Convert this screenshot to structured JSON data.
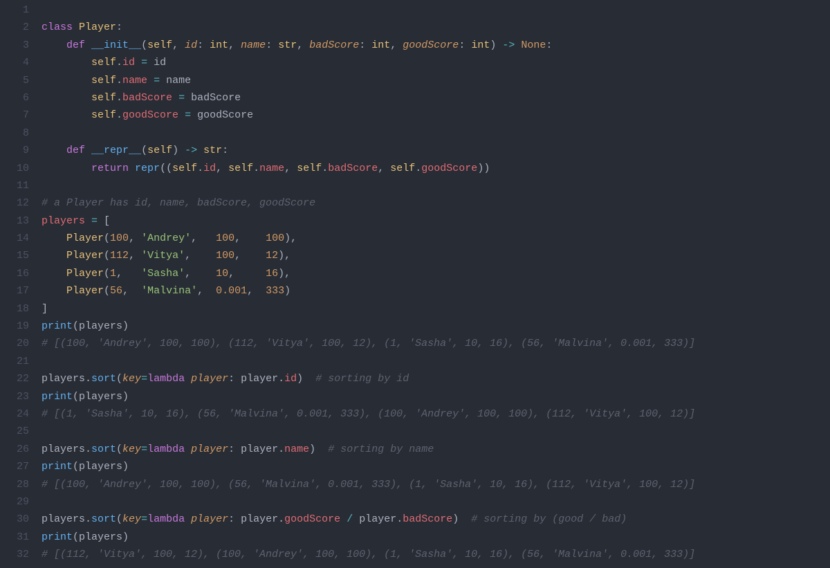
{
  "lineCount": 32,
  "lines": [
    [],
    [
      [
        "k",
        "class"
      ],
      [
        "p",
        " "
      ],
      [
        "cls",
        "Player"
      ],
      [
        "p",
        ":"
      ]
    ],
    [
      [
        "p",
        "    "
      ],
      [
        "k",
        "def"
      ],
      [
        "p",
        " "
      ],
      [
        "fn",
        "__init__"
      ],
      [
        "p",
        "("
      ],
      [
        "self",
        "self"
      ],
      [
        "p",
        ", "
      ],
      [
        "par",
        "id"
      ],
      [
        "p",
        ": "
      ],
      [
        "cls",
        "int"
      ],
      [
        "p",
        ", "
      ],
      [
        "par",
        "name"
      ],
      [
        "p",
        ": "
      ],
      [
        "cls",
        "str"
      ],
      [
        "p",
        ", "
      ],
      [
        "par",
        "badScore"
      ],
      [
        "p",
        ": "
      ],
      [
        "cls",
        "int"
      ],
      [
        "p",
        ", "
      ],
      [
        "par",
        "goodScore"
      ],
      [
        "p",
        ": "
      ],
      [
        "cls",
        "int"
      ],
      [
        "p",
        ") "
      ],
      [
        "op",
        "->"
      ],
      [
        "p",
        " "
      ],
      [
        "none",
        "None"
      ],
      [
        "p",
        ":"
      ]
    ],
    [
      [
        "p",
        "        "
      ],
      [
        "self",
        "self"
      ],
      [
        "p",
        "."
      ],
      [
        "attr",
        "id"
      ],
      [
        "p",
        " "
      ],
      [
        "op",
        "="
      ],
      [
        "p",
        " "
      ],
      [
        "p",
        "id"
      ]
    ],
    [
      [
        "p",
        "        "
      ],
      [
        "self",
        "self"
      ],
      [
        "p",
        "."
      ],
      [
        "attr",
        "name"
      ],
      [
        "p",
        " "
      ],
      [
        "op",
        "="
      ],
      [
        "p",
        " "
      ],
      [
        "p",
        "name"
      ]
    ],
    [
      [
        "p",
        "        "
      ],
      [
        "self",
        "self"
      ],
      [
        "p",
        "."
      ],
      [
        "attr",
        "badScore"
      ],
      [
        "p",
        " "
      ],
      [
        "op",
        "="
      ],
      [
        "p",
        " "
      ],
      [
        "p",
        "badScore"
      ]
    ],
    [
      [
        "p",
        "        "
      ],
      [
        "self",
        "self"
      ],
      [
        "p",
        "."
      ],
      [
        "attr",
        "goodScore"
      ],
      [
        "p",
        " "
      ],
      [
        "op",
        "="
      ],
      [
        "p",
        " "
      ],
      [
        "p",
        "goodScore"
      ]
    ],
    [],
    [
      [
        "p",
        "    "
      ],
      [
        "k",
        "def"
      ],
      [
        "p",
        " "
      ],
      [
        "fn",
        "__repr__"
      ],
      [
        "p",
        "("
      ],
      [
        "self",
        "self"
      ],
      [
        "p",
        ") "
      ],
      [
        "op",
        "->"
      ],
      [
        "p",
        " "
      ],
      [
        "cls",
        "str"
      ],
      [
        "p",
        ":"
      ]
    ],
    [
      [
        "p",
        "        "
      ],
      [
        "k",
        "return"
      ],
      [
        "p",
        " "
      ],
      [
        "fn",
        "repr"
      ],
      [
        "p",
        "(("
      ],
      [
        "self",
        "self"
      ],
      [
        "p",
        "."
      ],
      [
        "attr",
        "id"
      ],
      [
        "p",
        ", "
      ],
      [
        "self",
        "self"
      ],
      [
        "p",
        "."
      ],
      [
        "attr",
        "name"
      ],
      [
        "p",
        ", "
      ],
      [
        "self",
        "self"
      ],
      [
        "p",
        "."
      ],
      [
        "attr",
        "badScore"
      ],
      [
        "p",
        ", "
      ],
      [
        "self",
        "self"
      ],
      [
        "p",
        "."
      ],
      [
        "attr",
        "goodScore"
      ],
      [
        "p",
        "))"
      ]
    ],
    [],
    [
      [
        "c",
        "# a Player has id, name, badScore, goodScore"
      ]
    ],
    [
      [
        "var",
        "players"
      ],
      [
        "p",
        " "
      ],
      [
        "op",
        "="
      ],
      [
        "p",
        " ["
      ]
    ],
    [
      [
        "p",
        "    "
      ],
      [
        "cls",
        "Player"
      ],
      [
        "p",
        "("
      ],
      [
        "n",
        "100"
      ],
      [
        "p",
        ", "
      ],
      [
        "s",
        "'Andrey'"
      ],
      [
        "p",
        ",   "
      ],
      [
        "n",
        "100"
      ],
      [
        "p",
        ",    "
      ],
      [
        "n",
        "100"
      ],
      [
        "p",
        "),"
      ]
    ],
    [
      [
        "p",
        "    "
      ],
      [
        "cls",
        "Player"
      ],
      [
        "p",
        "("
      ],
      [
        "n",
        "112"
      ],
      [
        "p",
        ", "
      ],
      [
        "s",
        "'Vitya'"
      ],
      [
        "p",
        ",    "
      ],
      [
        "n",
        "100"
      ],
      [
        "p",
        ",    "
      ],
      [
        "n",
        "12"
      ],
      [
        "p",
        "),"
      ]
    ],
    [
      [
        "p",
        "    "
      ],
      [
        "cls",
        "Player"
      ],
      [
        "p",
        "("
      ],
      [
        "n",
        "1"
      ],
      [
        "p",
        ",   "
      ],
      [
        "s",
        "'Sasha'"
      ],
      [
        "p",
        ",    "
      ],
      [
        "n",
        "10"
      ],
      [
        "p",
        ",     "
      ],
      [
        "n",
        "16"
      ],
      [
        "p",
        "),"
      ]
    ],
    [
      [
        "p",
        "    "
      ],
      [
        "cls",
        "Player"
      ],
      [
        "p",
        "("
      ],
      [
        "n",
        "56"
      ],
      [
        "p",
        ",  "
      ],
      [
        "s",
        "'Malvina'"
      ],
      [
        "p",
        ",  "
      ],
      [
        "n",
        "0.001"
      ],
      [
        "p",
        ",  "
      ],
      [
        "n",
        "333"
      ],
      [
        "p",
        ")"
      ]
    ],
    [
      [
        "p",
        "]"
      ]
    ],
    [
      [
        "fn",
        "print"
      ],
      [
        "p",
        "("
      ],
      [
        "p",
        "players"
      ],
      [
        "p",
        ")"
      ]
    ],
    [
      [
        "c",
        "# [(100, 'Andrey', 100, 100), (112, 'Vitya', 100, 12), (1, 'Sasha', 10, 16), (56, 'Malvina', 0.001, 333)]"
      ]
    ],
    [],
    [
      [
        "p",
        "players."
      ],
      [
        "fn",
        "sort"
      ],
      [
        "p",
        "("
      ],
      [
        "par",
        "key"
      ],
      [
        "op",
        "="
      ],
      [
        "k",
        "lambda"
      ],
      [
        "p",
        " "
      ],
      [
        "par",
        "player"
      ],
      [
        "p",
        ": "
      ],
      [
        "p",
        "player."
      ],
      [
        "attr",
        "id"
      ],
      [
        "p",
        ")  "
      ],
      [
        "c",
        "# sorting by id"
      ]
    ],
    [
      [
        "fn",
        "print"
      ],
      [
        "p",
        "("
      ],
      [
        "p",
        "players"
      ],
      [
        "p",
        ")"
      ]
    ],
    [
      [
        "c",
        "# [(1, 'Sasha', 10, 16), (56, 'Malvina', 0.001, 333), (100, 'Andrey', 100, 100), (112, 'Vitya', 100, 12)]"
      ]
    ],
    [],
    [
      [
        "p",
        "players."
      ],
      [
        "fn",
        "sort"
      ],
      [
        "p",
        "("
      ],
      [
        "par",
        "key"
      ],
      [
        "op",
        "="
      ],
      [
        "k",
        "lambda"
      ],
      [
        "p",
        " "
      ],
      [
        "par",
        "player"
      ],
      [
        "p",
        ": "
      ],
      [
        "p",
        "player."
      ],
      [
        "attr",
        "name"
      ],
      [
        "p",
        ")  "
      ],
      [
        "c",
        "# sorting by name"
      ]
    ],
    [
      [
        "fn",
        "print"
      ],
      [
        "p",
        "("
      ],
      [
        "p",
        "players"
      ],
      [
        "p",
        ")"
      ]
    ],
    [
      [
        "c",
        "# [(100, 'Andrey', 100, 100), (56, 'Malvina', 0.001, 333), (1, 'Sasha', 10, 16), (112, 'Vitya', 100, 12)]"
      ]
    ],
    [],
    [
      [
        "p",
        "players."
      ],
      [
        "fn",
        "sort"
      ],
      [
        "p",
        "("
      ],
      [
        "par",
        "key"
      ],
      [
        "op",
        "="
      ],
      [
        "k",
        "lambda"
      ],
      [
        "p",
        " "
      ],
      [
        "par",
        "player"
      ],
      [
        "p",
        ": "
      ],
      [
        "p",
        "player."
      ],
      [
        "attr",
        "goodScore"
      ],
      [
        "p",
        " "
      ],
      [
        "op",
        "/"
      ],
      [
        "p",
        " "
      ],
      [
        "p",
        "player."
      ],
      [
        "attr",
        "badScore"
      ],
      [
        "p",
        ")  "
      ],
      [
        "c",
        "# sorting by (good / bad)"
      ]
    ],
    [
      [
        "fn",
        "print"
      ],
      [
        "p",
        "("
      ],
      [
        "p",
        "players"
      ],
      [
        "p",
        ")"
      ]
    ],
    [
      [
        "c",
        "# [(112, 'Vitya', 100, 12), (100, 'Andrey', 100, 100), (1, 'Sasha', 10, 16), (56, 'Malvina', 0.001, 333)]"
      ]
    ]
  ]
}
